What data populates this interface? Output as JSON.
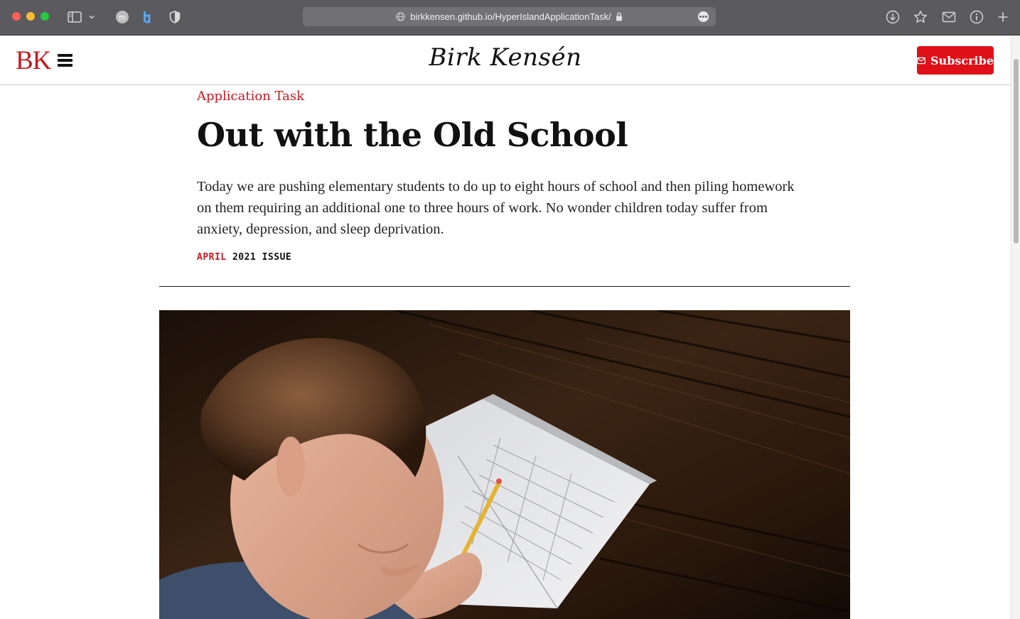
{
  "browser": {
    "url": "birkkensen.github.io/HyperIslandApplicationTask/",
    "icons": [
      "sidebar-icon",
      "chevron-down-icon",
      "extension-icon-m",
      "extension-icon-b",
      "shield-icon",
      "globe-icon",
      "lock-icon",
      "more-icon",
      "download-icon",
      "star-icon",
      "mail-icon",
      "info-icon",
      "plus-icon"
    ]
  },
  "header": {
    "logo": "BK",
    "site_title": "Birk Kensén",
    "subscribe_label": "Subscribe",
    "menu_icon": "hamburger-icon",
    "subscribe_icon": "envelope-icon"
  },
  "article": {
    "category": "Application Task",
    "headline": "Out with the Old School",
    "lede": "Today we are pushing elementary students to do up to eight hours of school and then piling homework on them requiring an additional one to three hours of work. No wonder children today suffer from anxiety, depression, and sleep deprivation.",
    "issue_month": "APRIL",
    "issue_rest": "2021 ISSUE"
  },
  "colors": {
    "brand_red": "#c8181f",
    "subscribe_red": "#e01018",
    "chrome_gray": "#5a5a5f"
  }
}
